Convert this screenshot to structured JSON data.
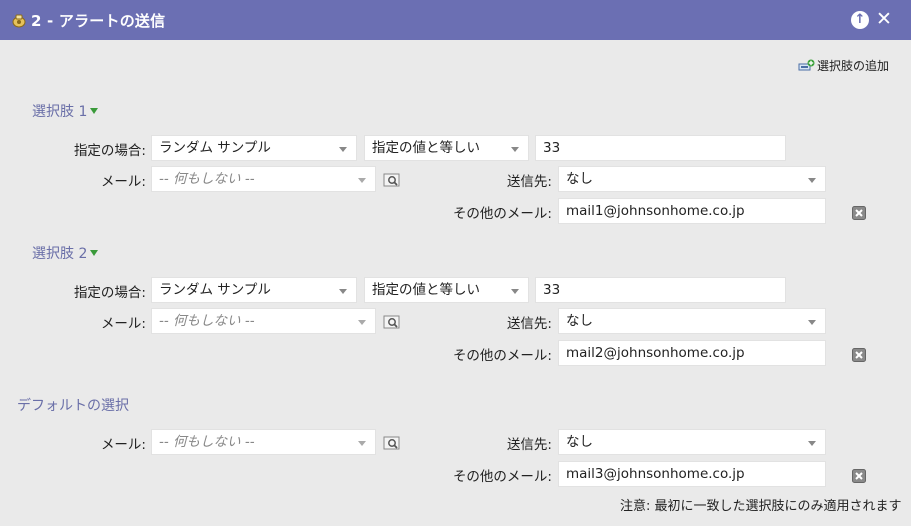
{
  "dialog": {
    "title": "2 - アラートの送信",
    "up_symbol": "↑",
    "close_symbol": "✕"
  },
  "add_choice_label": "選択肢の追加",
  "field_labels": {
    "condition": "指定の場合:",
    "email": "メール:",
    "send_to": "送信先:",
    "other_email": "その他のメール:"
  },
  "choices": [
    {
      "title": "選択肢 1",
      "condition_field": "ランダム サンプル",
      "operator": "指定の値と等しい",
      "value": "33",
      "email": "-- 何もしない --",
      "send_to": "なし",
      "other_email": "mail1@johnsonhome.co.jp"
    },
    {
      "title": "選択肢 2",
      "condition_field": "ランダム サンプル",
      "operator": "指定の値と等しい",
      "value": "33",
      "email": "-- 何もしない --",
      "send_to": "なし",
      "other_email": "mail2@johnsonhome.co.jp"
    }
  ],
  "default_choice": {
    "title": "デフォルトの選択",
    "email": "-- 何もしない --",
    "send_to": "なし",
    "other_email": "mail3@johnsonhome.co.jp"
  },
  "note": "注意: 最初に一致した選択肢にのみ適用されます",
  "colors": {
    "titlebar": "#6b6fb3",
    "section_title": "#6a6fa8",
    "background": "#eaeaea"
  }
}
